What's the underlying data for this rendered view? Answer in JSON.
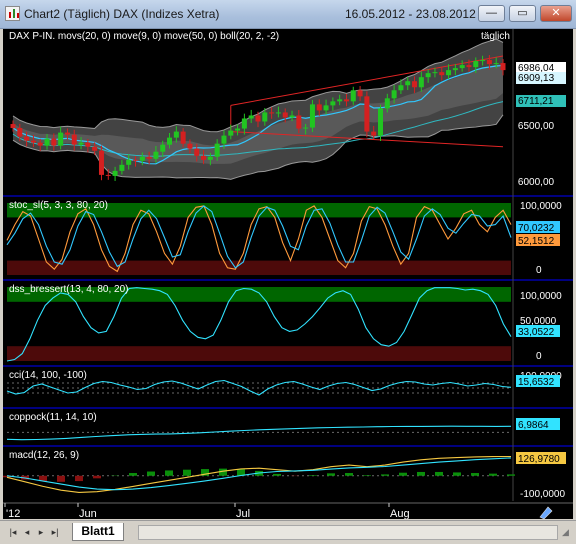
{
  "window": {
    "title": "Chart2 (Täglich)  DAX (Indizes Xetra)",
    "date_range": "16.05.2012 - 23.08.2012",
    "minimize_label": "—",
    "maximize_label": "▭",
    "close_label": "✕"
  },
  "bottom": {
    "sheet_tab": "Blatt1",
    "nav_first": "|◂",
    "nav_prev": "◂",
    "nav_next": "▸",
    "nav_last": "▸|"
  },
  "chart_data": [
    {
      "type": "candlestick",
      "title": "DAX P-IN. movs(20, 0) move(9, 0) move(50, 0) boll(20, 2, -2)",
      "interval_label": "täglich",
      "x_ticks": [
        "'12",
        "Jun",
        "Jul",
        "Aug"
      ],
      "y_ticks": [
        "6500,00",
        "6000,00"
      ],
      "value_labels": [
        "6986,04",
        "6909,13",
        "6711,21"
      ],
      "ylim": [
        5850,
        7200
      ],
      "close": [
        6455,
        6370,
        6330,
        6310,
        6280,
        6350,
        6280,
        6410,
        6390,
        6290,
        6310,
        6270,
        6230,
        5990,
        5980,
        6030,
        6090,
        6140,
        6130,
        6170,
        6150,
        6220,
        6290,
        6360,
        6420,
        6300,
        6250,
        6180,
        6140,
        6170,
        6300,
        6380,
        6430,
        6450,
        6550,
        6580,
        6520,
        6610,
        6600,
        6610,
        6560,
        6580,
        6450,
        6460,
        6690,
        6630,
        6680,
        6720,
        6740,
        6720,
        6830,
        6770,
        6420,
        6380,
        6650,
        6750,
        6830,
        6880,
        6920,
        6860,
        6960,
        7000,
        7010,
        6980,
        7030,
        7050,
        7080,
        7060,
        7120,
        7130,
        7090,
        7100,
        7030
      ],
      "volatility_band": [
        6300,
        6580
      ],
      "colors": {
        "up": "#21c521",
        "down": "#d42020",
        "upper_trend": "#e02525",
        "moving_avg": "#31c8ff",
        "bollinger_fill": "#4a4a4a"
      }
    },
    {
      "type": "line",
      "title": "stoc_sl(5, 3, 3, 80, 20)",
      "y_ticks": [
        "100,0000",
        "0"
      ],
      "value_labels": [
        "70,0232",
        "52,1512"
      ],
      "ylim": [
        0,
        100
      ],
      "overbought": 80,
      "oversold": 20,
      "series": [
        {
          "values": [
            48,
            70,
            88,
            82,
            50,
            18,
            8,
            22,
            60,
            85,
            92,
            70,
            35,
            12,
            5,
            30,
            70,
            90,
            85,
            60,
            30,
            15,
            40,
            80,
            94,
            96,
            70,
            30,
            10,
            8,
            30,
            70,
            92,
            95,
            80,
            45,
            20,
            50,
            90,
            96,
            80,
            50,
            20,
            10,
            30,
            75,
            95,
            92,
            70,
            40,
            15,
            30,
            80,
            95,
            90,
            70,
            50,
            65,
            85,
            90,
            70,
            60,
            80,
            90,
            70
          ]
        },
        {
          "values": [
            42,
            58,
            78,
            86,
            70,
            40,
            18,
            15,
            35,
            68,
            88,
            84,
            60,
            32,
            12,
            18,
            50,
            78,
            90,
            78,
            52,
            25,
            28,
            60,
            86,
            96,
            88,
            58,
            26,
            10,
            18,
            52,
            82,
            94,
            90,
            68,
            40,
            35,
            68,
            90,
            92,
            72,
            42,
            18,
            18,
            48,
            82,
            94,
            86,
            60,
            32,
            22,
            50,
            82,
            92,
            84,
            65,
            58,
            72,
            84,
            82,
            68,
            70,
            82,
            52
          ]
        }
      ]
    },
    {
      "type": "line",
      "title": "dss_bressert(13, 4, 80, 20)",
      "y_ticks": [
        "100,0000",
        "50,0000",
        "0"
      ],
      "value_labels": [
        "33,0522"
      ],
      "ylim": [
        0,
        100
      ],
      "series": [
        {
          "values": [
            0,
            2,
            10,
            30,
            55,
            75,
            85,
            92,
            90,
            80,
            60,
            45,
            38,
            40,
            60,
            85,
            98,
            99,
            98,
            97,
            95,
            90,
            75,
            55,
            40,
            32,
            30,
            35,
            55,
            80,
            95,
            98,
            97,
            92,
            80,
            60,
            45,
            40,
            42,
            50,
            60,
            72,
            85,
            92,
            95,
            90,
            70,
            45,
            30,
            22,
            20,
            25,
            40,
            62,
            85,
            95,
            99,
            99,
            99,
            98,
            96,
            97,
            95,
            90,
            75,
            50,
            33
          ]
        }
      ]
    },
    {
      "type": "line",
      "title": "cci(14, 100, -100)",
      "y_ticks": [
        "100,0000"
      ],
      "value_labels": [
        "15,6532"
      ],
      "ylim": [
        -300,
        300
      ],
      "series": [
        {
          "values": [
            -60,
            -120,
            -90,
            40,
            80,
            20,
            -40,
            -100,
            -80,
            10,
            90,
            130,
            110,
            60,
            20,
            -30,
            -10,
            70,
            120,
            140,
            100,
            40,
            -20,
            60,
            130,
            150,
            90,
            30,
            -60,
            -140,
            -20,
            60,
            110,
            130,
            80,
            20,
            -30,
            40,
            90,
            110,
            70,
            10,
            -50,
            -20,
            50,
            100,
            130,
            120,
            80,
            60,
            90,
            110,
            80,
            40,
            60,
            90,
            70,
            30,
            15
          ]
        }
      ]
    },
    {
      "type": "line",
      "title": "coppock(11, 14, 10)",
      "value_labels": [
        "6,9864"
      ],
      "ylim": [
        -10,
        20
      ],
      "series": [
        {
          "values": [
            -8,
            -8.5,
            -8.3,
            -7.8,
            -7,
            -5.8,
            -4.8,
            -3.9,
            -3,
            -2.4,
            -2,
            -1.8,
            -1.2,
            -0.5,
            0.4,
            1.3,
            2.1,
            2.9,
            3.5,
            4.1,
            4.7,
            5.2,
            5.6,
            5.9,
            6.2,
            6.5,
            6.7,
            6.8,
            6.9,
            7,
            7.1,
            7,
            6.95,
            6.9,
            6.99
          ]
        }
      ]
    },
    {
      "type": "line",
      "title": "macd(12, 26, 9)",
      "y_ticks": [
        "-100,0000"
      ],
      "value_labels": [
        "126,9780"
      ],
      "ylim": [
        -140,
        150
      ],
      "series": [
        {
          "values": [
            -10,
            -40,
            -70,
            -95,
            -110,
            -105,
            -90,
            -70,
            -50,
            -30,
            -10,
            10,
            30,
            45,
            50,
            40,
            30,
            40,
            60,
            70,
            60,
            70,
            90,
            105,
            115,
            120,
            124,
            126,
            127
          ]
        },
        {
          "values": [
            0,
            -15,
            -35,
            -55,
            -75,
            -88,
            -92,
            -88,
            -78,
            -65,
            -50,
            -34,
            -17,
            2,
            18,
            28,
            32,
            36,
            44,
            52,
            56,
            61,
            70,
            80,
            90,
            98,
            106,
            112,
            118
          ]
        }
      ],
      "histogram": [
        -10,
        -25,
        -35,
        -40,
        -35,
        -17,
        2,
        18,
        28,
        35,
        40,
        44,
        47,
        43,
        32,
        12,
        -2,
        4,
        16,
        18,
        4,
        9,
        20,
        25,
        25,
        22,
        18,
        14,
        9
      ]
    }
  ]
}
